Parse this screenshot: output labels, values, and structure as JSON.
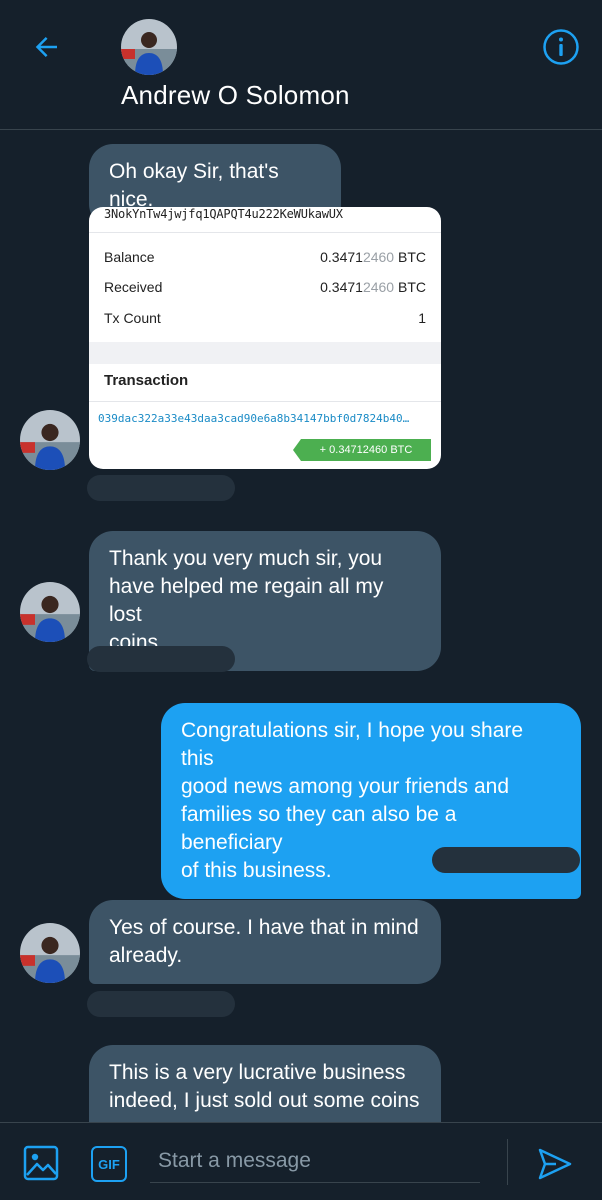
{
  "header": {
    "name": "Andrew O Solomon",
    "back_icon": "arrow-left-icon",
    "info_icon": "info-circle-icon",
    "accent_color": "#1da1f2"
  },
  "messages": [
    {
      "direction": "incoming",
      "text": "Oh okay Sir, that's nice."
    },
    {
      "direction": "incoming",
      "type": "image",
      "card": {
        "address": "3NokYnTw4jwjfq1QAPQT4u222KeWUkawUX",
        "rows": [
          {
            "label": "Balance",
            "value_main": "0.3471",
            "value_dim": "2460",
            "unit": " BTC"
          },
          {
            "label": "Received",
            "value_main": "0.3471",
            "value_dim": "2460",
            "unit": " BTC"
          },
          {
            "label": "Tx Count",
            "value_main": "1",
            "value_dim": "",
            "unit": ""
          }
        ],
        "section_title": "Transaction",
        "tx_hash": "039dac322a33e43daa3cad90e6a8b34147bbf0d7824b40…",
        "tx_amount": "+ 0.34712460 BTC"
      }
    },
    {
      "direction": "incoming",
      "text": "Thank you very much sir, you\nhave helped me regain all my lost\ncoins."
    },
    {
      "direction": "outgoing",
      "text": "Congratulations sir, I hope you share this\ngood news among your friends and\nfamilies so they can also be a beneficiary\nof this business."
    },
    {
      "direction": "incoming",
      "text": "Yes of course. I have that in mind\nalready."
    },
    {
      "direction": "incoming",
      "text": "This is a very lucrative business\nindeed, I just sold out some coins"
    }
  ],
  "composer": {
    "placeholder": "Start a message",
    "gif_label": "GIF",
    "media_icon": "image-icon",
    "send_icon": "send-icon"
  },
  "colors": {
    "background": "#15202b",
    "incoming_bubble": "#3d5466",
    "outgoing_bubble": "#1da1f2",
    "badge_green": "#4caf50"
  }
}
